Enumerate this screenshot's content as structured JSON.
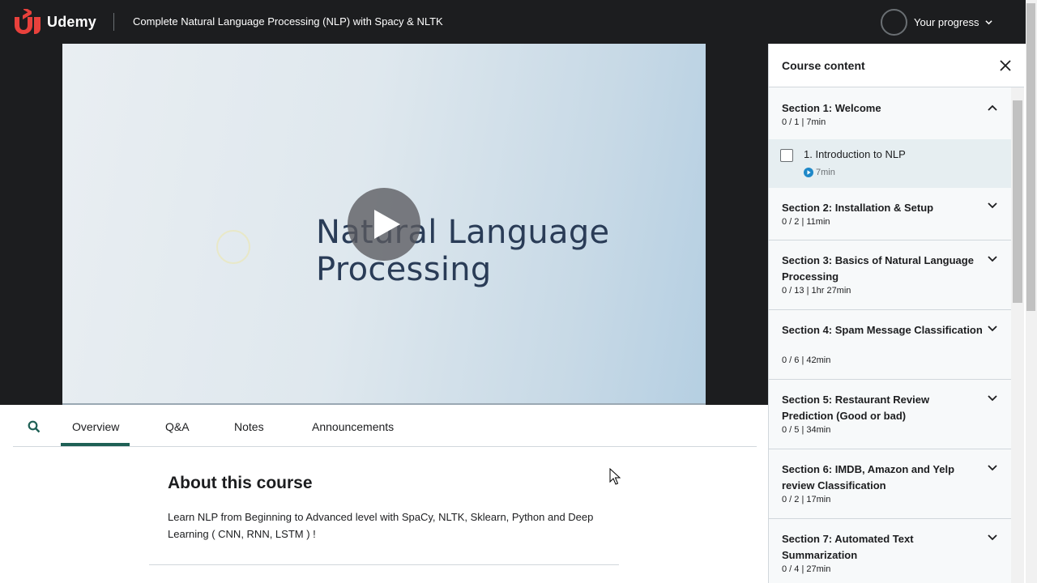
{
  "header": {
    "brand": "Udemy",
    "course_title": "Complete Natural Language Processing (NLP) with Spacy & NLTK",
    "progress_label": "Your progress"
  },
  "video": {
    "slide_line1": "Natural Language",
    "slide_line2": "Processing"
  },
  "tabs": [
    {
      "label": "Overview",
      "active": true
    },
    {
      "label": "Q&A",
      "active": false
    },
    {
      "label": "Notes",
      "active": false
    },
    {
      "label": "Announcements",
      "active": false
    }
  ],
  "about": {
    "title": "About this course",
    "description": "Learn NLP from Beginning to Advanced level with SpaCy, NLTK, Sklearn, Python and Deep Learning ( CNN, RNN, LSTM ) !"
  },
  "sidebar": {
    "title": "Course content",
    "sections": [
      {
        "title": "Section 1: Welcome",
        "meta": "0 / 1 | 7min",
        "expanded": true
      },
      {
        "title": "Section 2: Installation & Setup",
        "meta": "0 / 2 | 11min",
        "expanded": false
      },
      {
        "title": "Section 3: Basics of Natural Language Processing",
        "meta": "0 / 13 | 1hr 27min",
        "expanded": false
      },
      {
        "title": "Section 4: Spam Message Classification",
        "meta": "0 / 6 | 42min",
        "expanded": false
      },
      {
        "title": "Section 5: Restaurant Review Prediction (Good or bad)",
        "meta": "0 / 5 | 34min",
        "expanded": false
      },
      {
        "title": "Section 6: IMDB, Amazon and Yelp review Classification",
        "meta": "0 / 2 | 17min",
        "expanded": false
      },
      {
        "title": "Section 7: Automated Text Summarization",
        "meta": "0 / 4 | 27min",
        "expanded": false
      }
    ],
    "lecture": {
      "title": "1. Introduction to NLP",
      "duration": "7min"
    }
  },
  "colors": {
    "header_bg": "#1c1d1f",
    "brand_red": "#a435f0",
    "tab_accent": "#1e6055",
    "lecture_highlight": "#e6eef1",
    "play_icon": "#1e88c8"
  }
}
